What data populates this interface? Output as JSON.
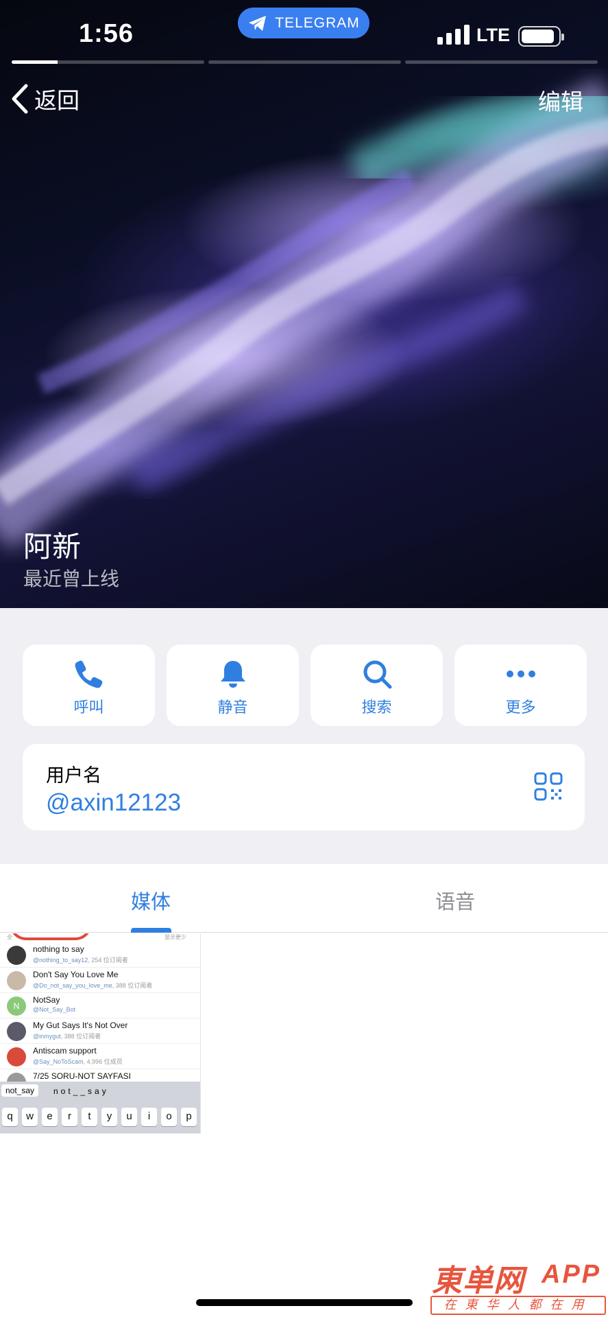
{
  "status_bar": {
    "time": "1:56",
    "app_pill": "TELEGRAM",
    "network": "LTE",
    "battery_level": 0.9
  },
  "story": {
    "segments": [
      0.24,
      0,
      0
    ]
  },
  "nav": {
    "back_label": "返回",
    "edit_label": "编辑"
  },
  "profile": {
    "name": "阿新",
    "status": "最近曾上线"
  },
  "actions": [
    {
      "label": "呼叫",
      "icon": "phone-icon"
    },
    {
      "label": "静音",
      "icon": "bell-icon"
    },
    {
      "label": "搜索",
      "icon": "search-icon"
    },
    {
      "label": "更多",
      "icon": "more-icon"
    }
  ],
  "username": {
    "label": "用户名",
    "value": "@axin12123",
    "icon": "qr-code-icon"
  },
  "tabs": {
    "media": "媒体",
    "voice": "语音",
    "active": "媒体"
  },
  "media_thumbnail": {
    "hint_left": "全",
    "hint_right": "显示更少",
    "rows": [
      {
        "title": "nothing to say",
        "handle": "@nothing_to_say12",
        "meta": ", 254 位订阅者",
        "avatar_color": "#3a3a3a"
      },
      {
        "title": "Don't Say You Love Me",
        "handle": "@Do_not_say_you_love_me",
        "meta": ", 388 位订阅者",
        "avatar_color": "#c9b9a8"
      },
      {
        "title": "NotSay",
        "handle": "@Not_Say_Bot",
        "meta": "",
        "avatar_color": "#8bc97a",
        "avatar_letter": "N"
      },
      {
        "title": "My Gut Says It's Not Over",
        "handle": "@inmygut",
        "meta": ", 388 位订阅者",
        "avatar_color": "#5a5a6a"
      },
      {
        "title": "Antiscam support",
        "handle": "@Say_NoToScam",
        "meta": ", 4,996 位成员",
        "avatar_color": "#d94a3a"
      },
      {
        "title": "7/25 SORU-NOT SAYFASI",
        "handle": "",
        "meta": "",
        "avatar_color": "#9a9a9a"
      }
    ],
    "keyboard": {
      "suggestion_1": "not_say",
      "suggestion_2": "not__say",
      "keys": [
        "q",
        "w",
        "e",
        "r",
        "t",
        "y",
        "u",
        "i",
        "o",
        "p"
      ]
    }
  },
  "watermark": {
    "main": "東单网",
    "app": "APP",
    "sub": "在東华人都在用"
  },
  "colors": {
    "accent": "#2f7fe0",
    "background": "#efeff4",
    "telegram_pill": "#3a7ff0",
    "watermark": "#e8553e"
  }
}
